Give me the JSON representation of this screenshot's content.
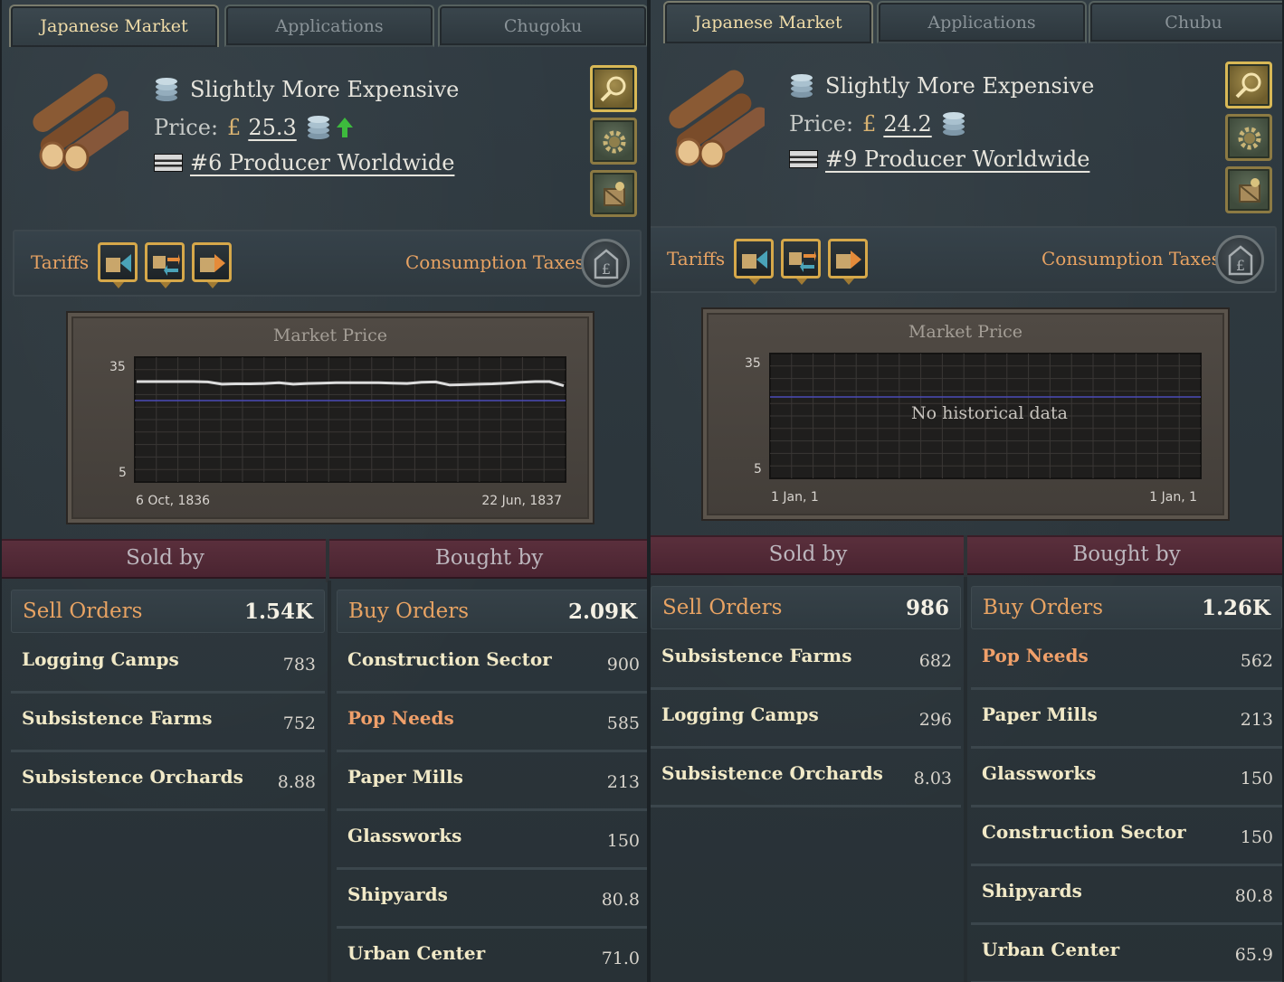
{
  "panels": [
    {
      "tabs": [
        "Japanese Market",
        "Applications",
        "Chugoku"
      ],
      "active_tab": 0,
      "header": {
        "status": "Slightly More Expensive",
        "price_label": "Price:",
        "currency": "£",
        "price": "25.3",
        "price_trend": "up",
        "producer": "#6 Producer Worldwide"
      },
      "tariffs_label": "Tariffs",
      "consumption_taxes_label": "Consumption Taxes",
      "chart_data": {
        "type": "line",
        "title": "Market Price",
        "y_ticks": [
          "35",
          "5"
        ],
        "ylim": [
          5,
          35
        ],
        "x_tick_labels": [
          "6 Oct, 1836",
          "22 Jun, 1837"
        ],
        "base_price": 25,
        "values": [
          30.0,
          30.0,
          30.0,
          30.0,
          30.0,
          29.9,
          29.3,
          29.4,
          29.4,
          29.5,
          29.7,
          29.3,
          29.5,
          29.6,
          29.7,
          29.7,
          29.7,
          29.7,
          29.6,
          29.5,
          29.8,
          29.9,
          29.1,
          29.2,
          29.3,
          29.4,
          29.6,
          29.8,
          30.0,
          30.0,
          28.9
        ],
        "grid": true,
        "empty_text": ""
      },
      "sold_by_title": "Sold by",
      "bought_by_title": "Bought by",
      "sell": {
        "label": "Sell Orders",
        "total": "1.54K",
        "rows": [
          {
            "name": "Logging Camps",
            "value": "783",
            "pop": false
          },
          {
            "name": "Subsistence Farms",
            "value": "752",
            "pop": false
          },
          {
            "name": "Subsistence Orchards",
            "value": "8.88",
            "pop": false
          }
        ]
      },
      "buy": {
        "label": "Buy Orders",
        "total": "2.09K",
        "rows": [
          {
            "name": "Construction Sector",
            "value": "900",
            "pop": false
          },
          {
            "name": "Pop Needs",
            "value": "585",
            "pop": true
          },
          {
            "name": "Paper Mills",
            "value": "213",
            "pop": false
          },
          {
            "name": "Glassworks",
            "value": "150",
            "pop": false
          },
          {
            "name": "Shipyards",
            "value": "80.8",
            "pop": false
          },
          {
            "name": "Urban Center",
            "value": "71.0",
            "pop": false
          }
        ]
      }
    },
    {
      "tabs": [
        "Japanese Market",
        "Applications",
        "Chubu"
      ],
      "active_tab": 0,
      "header": {
        "status": "Slightly More Expensive",
        "price_label": "Price:",
        "currency": "£",
        "price": "24.2",
        "price_trend": "none",
        "producer": "#9 Producer Worldwide"
      },
      "tariffs_label": "Tariffs",
      "consumption_taxes_label": "Consumption Taxes",
      "chart_data": {
        "type": "line",
        "title": "Market Price",
        "y_ticks": [
          "35",
          "5"
        ],
        "ylim": [
          5,
          35
        ],
        "x_tick_labels": [
          "1 Jan, 1",
          "1 Jan, 1"
        ],
        "base_price": 25,
        "values": [],
        "grid": true,
        "empty_text": "No historical data"
      },
      "sold_by_title": "Sold by",
      "bought_by_title": "Bought by",
      "sell": {
        "label": "Sell Orders",
        "total": "986",
        "rows": [
          {
            "name": "Subsistence Farms",
            "value": "682",
            "pop": false
          },
          {
            "name": "Logging Camps",
            "value": "296",
            "pop": false
          },
          {
            "name": "Subsistence Orchards",
            "value": "8.03",
            "pop": false
          }
        ]
      },
      "buy": {
        "label": "Buy Orders",
        "total": "1.26K",
        "rows": [
          {
            "name": "Pop Needs",
            "value": "562",
            "pop": true
          },
          {
            "name": "Paper Mills",
            "value": "213",
            "pop": false
          },
          {
            "name": "Glassworks",
            "value": "150",
            "pop": false
          },
          {
            "name": "Construction Sector",
            "value": "150",
            "pop": false
          },
          {
            "name": "Shipyards",
            "value": "80.8",
            "pop": false
          },
          {
            "name": "Urban Center",
            "value": "65.9",
            "pop": false
          }
        ]
      }
    }
  ]
}
